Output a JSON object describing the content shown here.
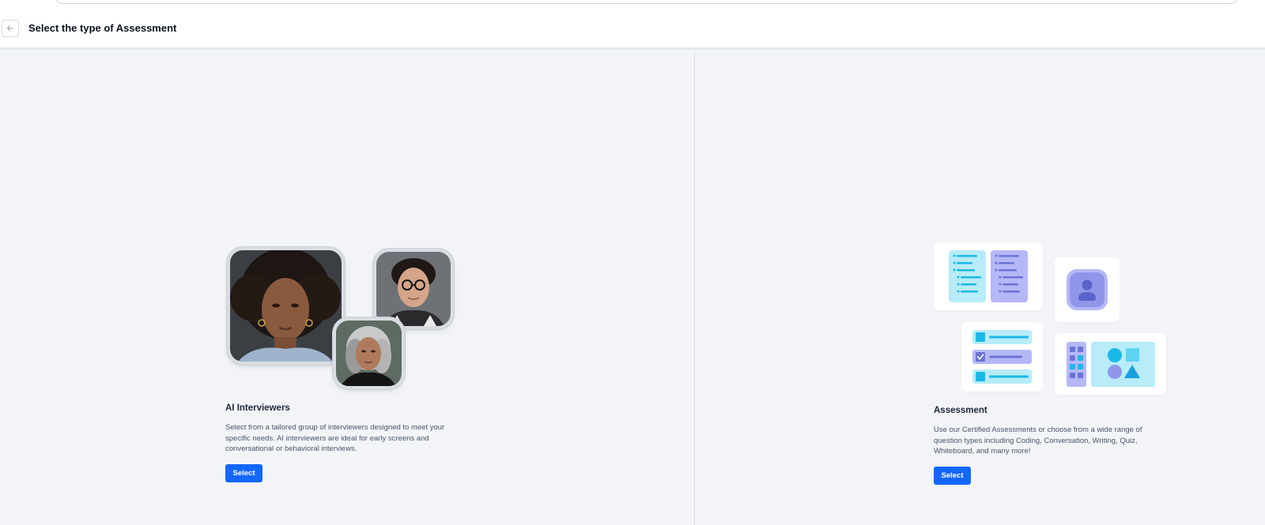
{
  "header": {
    "title": "Select the type of Assessment",
    "back_icon": "arrow-left-icon"
  },
  "options": [
    {
      "title": "AI Interviewers",
      "description": "Select from a tailored group of interviewers designed to meet your specific needs. AI interviewers are ideal for early screens and conversational or behavioral interviews.",
      "button_label": "Select",
      "illustration": "interviewer-portraits"
    },
    {
      "title": "Assessment",
      "description": "Use our Certified Assessments or choose from a wide range of question types including Coding, Conversation, Writing, Quiz, Whiteboard, and many more!",
      "button_label": "Select",
      "illustration": "question-type-tiles"
    }
  ],
  "colors": {
    "accent": "#1366ff",
    "background": "#f2f4f8",
    "illustration_cyan": "#1ab8e8",
    "illustration_purple": "#6b74d6"
  }
}
